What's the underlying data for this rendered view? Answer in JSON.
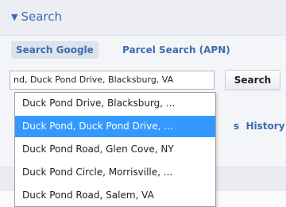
{
  "panel": {
    "title_arrow": "▼",
    "title": "Search"
  },
  "tabs": [
    {
      "label": "Search Google",
      "active": true
    },
    {
      "label": "Parcel Search (APN)",
      "active": false
    }
  ],
  "search": {
    "value": "nd, Duck Pond Drive, Blacksburg, VA",
    "button_label": "Search"
  },
  "history_label": "History",
  "history_prefix": "s",
  "suggestions": [
    {
      "text": "Duck Pond Drive, Blacksburg, ...",
      "selected": false
    },
    {
      "text": "Duck Pond, Duck Pond Drive, ...",
      "selected": true
    },
    {
      "text": "Duck Pond Road, Glen Cove, NY",
      "selected": false
    },
    {
      "text": "Duck Pond Circle, Morrisville, ...",
      "selected": false
    },
    {
      "text": "Duck Pond Road, Salem, VA",
      "selected": false
    }
  ],
  "colors": {
    "accent": "#3d6cae",
    "selection": "#3399ff"
  }
}
